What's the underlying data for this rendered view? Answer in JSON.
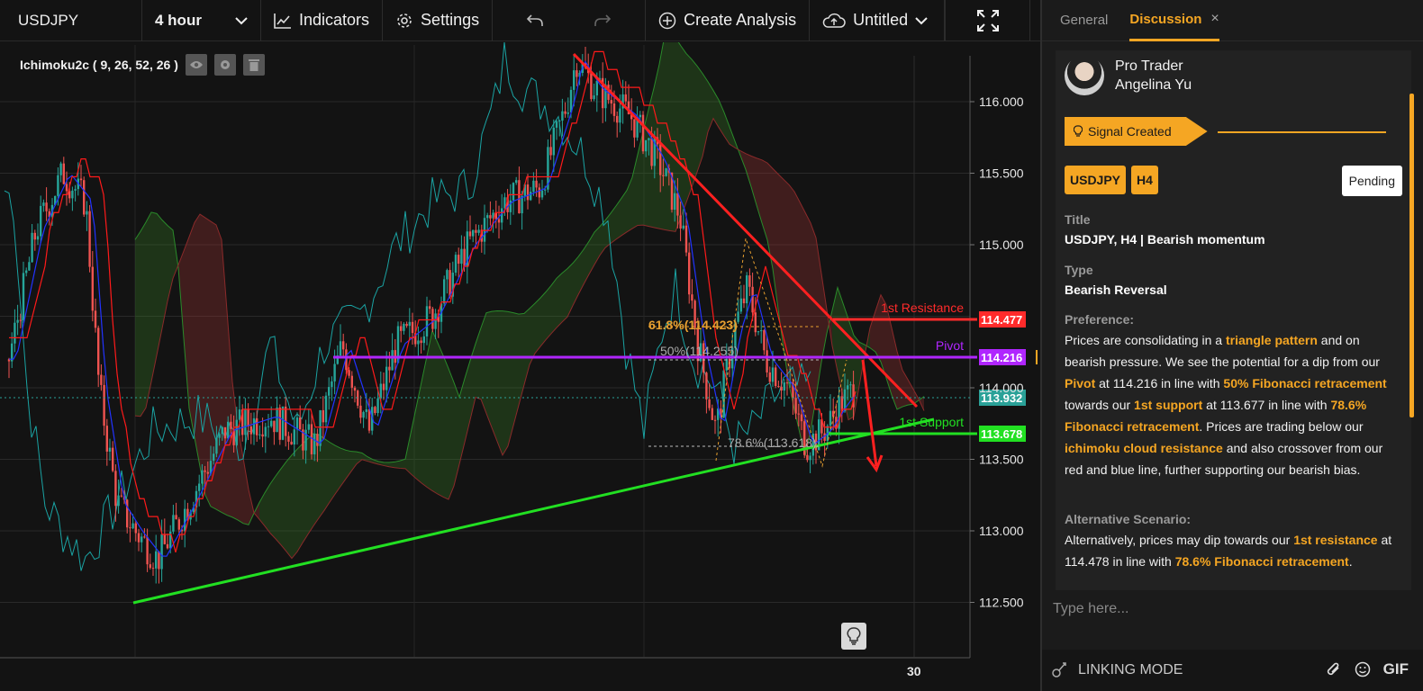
{
  "toolbar": {
    "symbol": "USDJPY",
    "interval": "4 hour",
    "indicators_label": "Indicators",
    "settings_label": "Settings",
    "create_analysis_label": "Create Analysis",
    "file_label": "Untitled"
  },
  "chart": {
    "indicator_legend": "Ichimoku2c ( 9, 26, 52, 26 )",
    "y_ticks": [
      "116.000",
      "115.500",
      "115.000",
      "114.000",
      "113.500",
      "113.000",
      "112.500"
    ],
    "y_tick_values": [
      116.0,
      115.5,
      115.0,
      114.0,
      113.5,
      113.0,
      112.5
    ],
    "x_tick": "30",
    "levels": [
      {
        "name": "1st Resistance",
        "price": "114.477",
        "color": "#ff2b2b"
      },
      {
        "name": "Pivot",
        "price": "114.216",
        "color": "#b026ff"
      },
      {
        "name": "",
        "price": "113.932",
        "color": "#2aa198"
      },
      {
        "name": "1st Support",
        "price": "113.678",
        "color": "#22e022"
      }
    ],
    "fib_labels": [
      "61.8%(114.423)",
      "50%(114.255)",
      "78.6%(113.618)"
    ],
    "colors": {
      "bull": "#26a69a",
      "bear": "#ef5350",
      "tenkan": "#2233ff",
      "kijun": "#ff1a1a",
      "chikou": "#1aa3a3",
      "span_a": "#2a8a2a",
      "span_b": "#8a2a2a"
    }
  },
  "panel": {
    "tabs": [
      "General",
      "Discussion"
    ],
    "active_tab": "Discussion",
    "author_role": "Pro Trader",
    "author_name": "Angelina Yu",
    "signal_label": "Signal Created",
    "badges": [
      "USDJPY",
      "H4"
    ],
    "status": "Pending",
    "title_label": "Title",
    "title_value": "USDJPY, H4 | Bearish momentum",
    "type_label": "Type",
    "type_value": "Bearish Reversal",
    "preference_label": "Preference:",
    "preference_segments": [
      {
        "t": "Prices are consolidating in a ",
        "h": false
      },
      {
        "t": "triangle pattern",
        "h": true
      },
      {
        "t": " and on bearish pressure. We see the potential for a dip from our ",
        "h": false
      },
      {
        "t": "Pivot",
        "h": true
      },
      {
        "t": " at 114.216 in line with ",
        "h": false
      },
      {
        "t": "50% Fibonacci retracement",
        "h": true
      },
      {
        "t": " towards our ",
        "h": false
      },
      {
        "t": "1st support",
        "h": true
      },
      {
        "t": " at 113.677 in line with ",
        "h": false
      },
      {
        "t": "78.6% Fibonacci retracement",
        "h": true
      },
      {
        "t": ". Prices are trading below our ",
        "h": false
      },
      {
        "t": "ichimoku cloud resistance",
        "h": true
      },
      {
        "t": " and also crossover from our red and blue line, further supporting our bearish bias.",
        "h": false
      }
    ],
    "alternative_label": "Alternative Scenario:",
    "alternative_segments": [
      {
        "t": "Alternatively, prices may dip towards our ",
        "h": false
      },
      {
        "t": "1st resistance",
        "h": true
      },
      {
        "t": " at 114.478 in line with ",
        "h": false
      },
      {
        "t": "78.6% Fibonacci retracement",
        "h": true
      },
      {
        "t": ".",
        "h": false
      }
    ],
    "input_placeholder": "Type here...",
    "linking_mode_label": "LINKING MODE",
    "gif_label": "GIF"
  }
}
